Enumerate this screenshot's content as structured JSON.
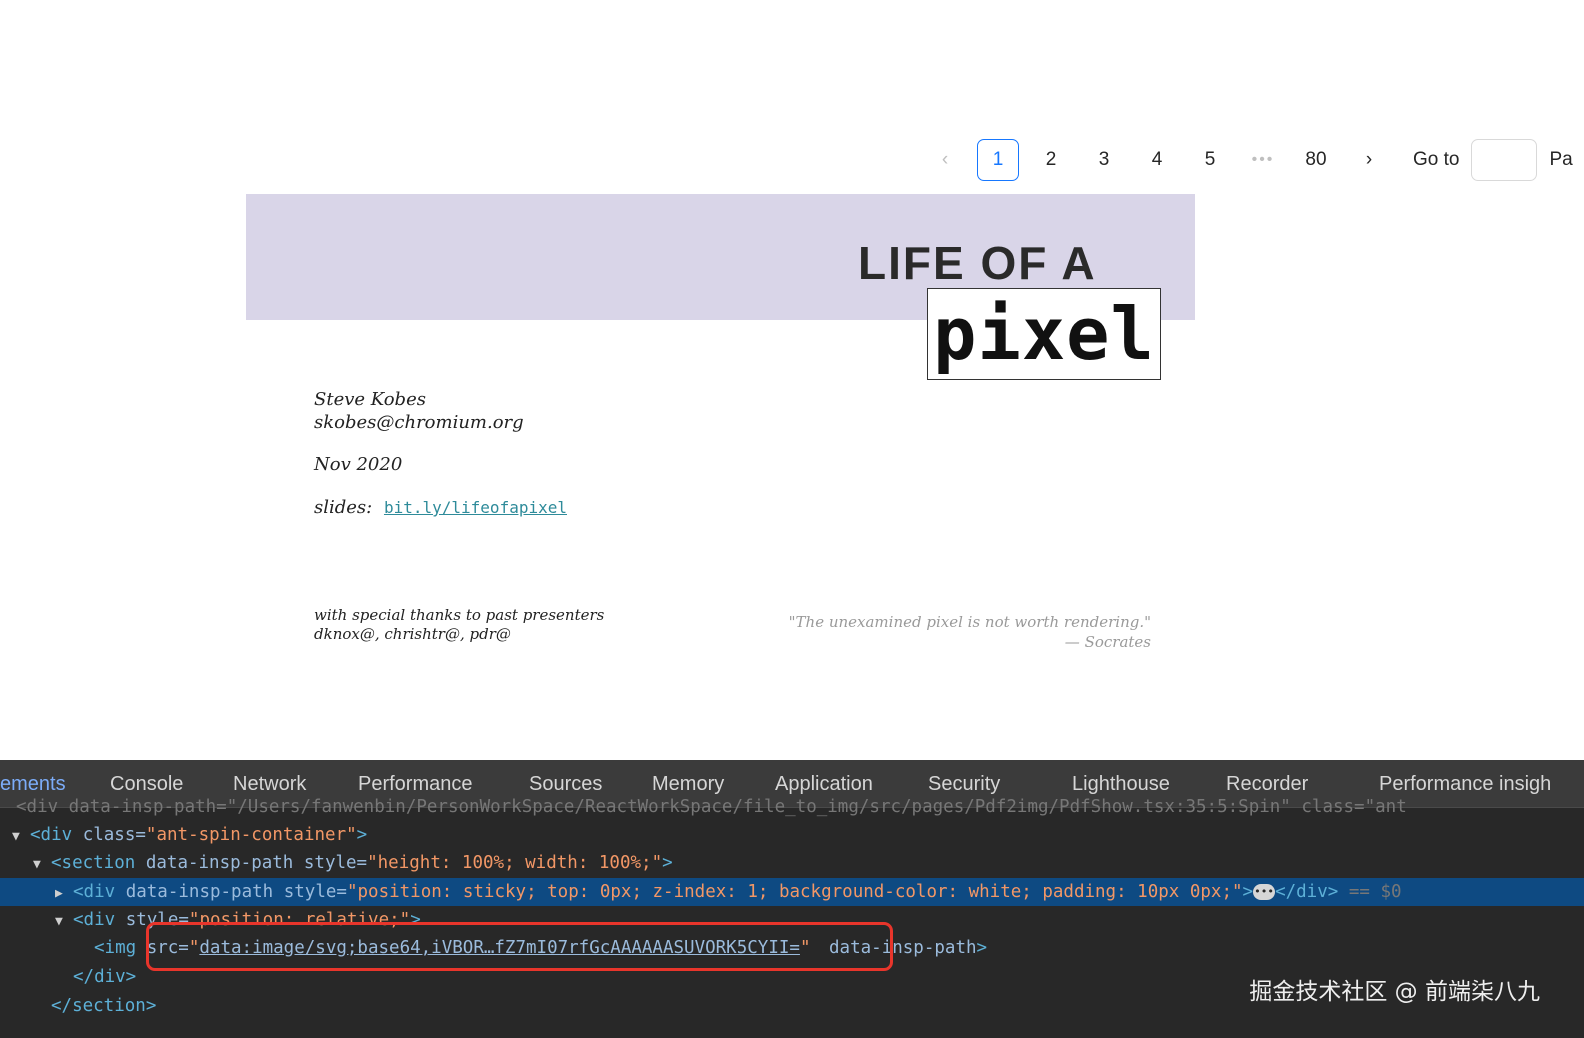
{
  "pagination": {
    "prev_icon": "‹",
    "pages": [
      "1",
      "2",
      "3",
      "4",
      "5"
    ],
    "active_page": "1",
    "ellipsis": "•••",
    "last_page": "80",
    "next_icon": "›",
    "goto_label": "Go to",
    "goto_suffix": "Pa",
    "accent_color": "#1677ff"
  },
  "slide": {
    "banner_color": "#d9d5e8",
    "title": "LIFE OF A",
    "title_pixel": "pixel",
    "author_name": "Steve Kobes",
    "author_email": "skobes@chromium.org",
    "date": "Nov 2020",
    "slides_label": "slides:",
    "slides_link": "bit.ly/lifeofapixel",
    "thanks_line1": "with special thanks to past presenters",
    "thanks_line2": "dknox@, chrishtr@, pdr@",
    "quote": "\"The unexamined pixel is not worth rendering.\"",
    "quote_attribution": "— Socrates"
  },
  "devtools": {
    "tabs": [
      "ements",
      "Console",
      "Network",
      "Performance",
      "Sources",
      "Memory",
      "Application",
      "Security",
      "Lighthouse",
      "Recorder",
      "Performance insigh"
    ],
    "active_tab": "ements",
    "lines": {
      "l0": "<div data-insp-path=\"/Users/fanwenbin/PersonWorkSpace/ReactWorkSpace/file_to_img/src/pages/Pdf2img/PdfShow.tsx:35:5:Spin\" class=\"ant",
      "l1_tag_open": "<div",
      "l1_attr": " class=",
      "l1_val": "\"ant-spin-container\"",
      "l1_close": ">",
      "l2_tag_open": "<section",
      "l2_attr1": " data-insp-path",
      "l2_attr2": " style=",
      "l2_val": "\"height: 100%; width: 100%;\"",
      "l2_close": ">",
      "l3_tag_open": "<div",
      "l3_attr1": " data-insp-path",
      "l3_attr2": " style=",
      "l3_val": "\"position: sticky; top: 0px; z-index: 1; background-color: white; padding: 10px 0px;\"",
      "l3_close": ">",
      "l3_more": "•••",
      "l3_end": "</div>",
      "l3_eq": " == $0",
      "l4_tag_open": "<div",
      "l4_attr": " style=",
      "l4_val": "\"position: relative;\"",
      "l4_close": ">",
      "l5_tag_open": "<img",
      "l5_attr": " src=",
      "l5_q1": "\"",
      "l5_link": "data:image/svg;base64,iVBOR…fZ7mI07rfGcAAAAAASUVORK5CYII=",
      "l5_q2": "\"",
      "l5_attr2": " data-insp-path",
      "l5_close": ">",
      "l6": "</div>",
      "l7": "</section>"
    },
    "highlight_color": "#e8352b"
  },
  "watermark": "掘金技术社区 @ 前端柒八九"
}
